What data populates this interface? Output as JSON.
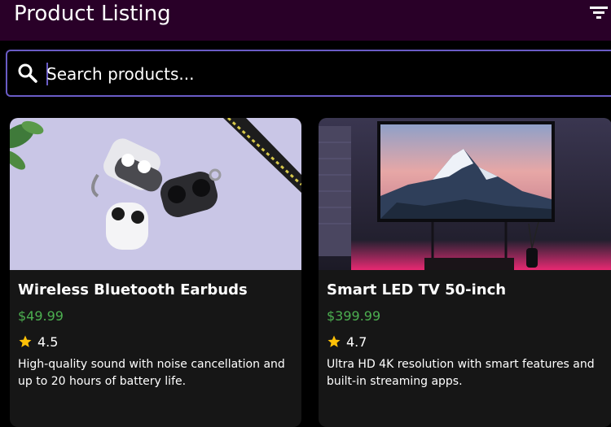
{
  "header": {
    "title": "Product Listing",
    "filter_icon": "filter-icon"
  },
  "search": {
    "placeholder": "Search products...",
    "icon": "search-icon"
  },
  "products": [
    {
      "title": "Wireless Bluetooth Earbuds",
      "price": "$49.99",
      "rating": "4.5",
      "description": "High-quality sound with noise cancellation and up to 20 hours of battery life.",
      "image": "earbuds-photo"
    },
    {
      "title": "Smart LED TV 50-inch",
      "price": "$399.99",
      "rating": "4.7",
      "description": "Ultra HD 4K resolution with smart features and built-in streaming apps.",
      "image": "tv-photo"
    }
  ],
  "colors": {
    "header_bg": "#290028",
    "search_border": "#6a5cc6",
    "price": "#4caf50",
    "star": "#ffc107",
    "card_bg": "#161616"
  }
}
